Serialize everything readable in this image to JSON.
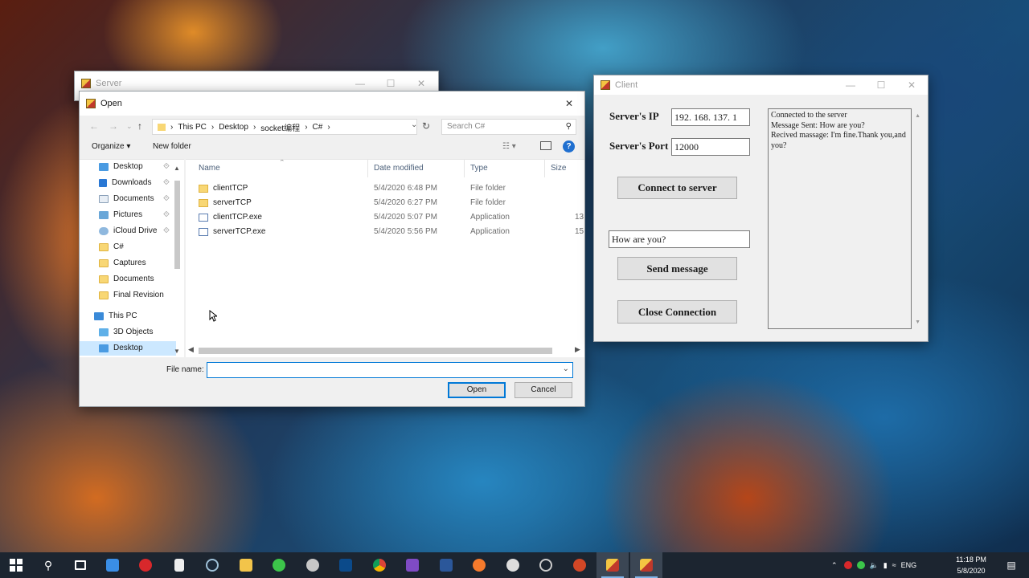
{
  "server_window": {
    "title": "Server"
  },
  "open_dialog": {
    "title": "Open",
    "path": [
      "This PC",
      "Desktop",
      "socket编程",
      "C#"
    ],
    "search_placeholder": "Search C#",
    "toolbar": {
      "organize": "Organize ▾",
      "new_folder": "New folder"
    },
    "nav_items": [
      {
        "label": "Desktop",
        "icon": "desktop-icon",
        "pinned": true
      },
      {
        "label": "Downloads",
        "icon": "download-icon",
        "pinned": true
      },
      {
        "label": "Documents",
        "icon": "documents-icon",
        "pinned": true
      },
      {
        "label": "Pictures",
        "icon": "pictures-icon",
        "pinned": true
      },
      {
        "label": "iCloud Drive",
        "icon": "cloud-icon",
        "pinned": true
      },
      {
        "label": "C#",
        "icon": "folder-icon",
        "pinned": false
      },
      {
        "label": "Captures",
        "icon": "folder-icon",
        "pinned": false
      },
      {
        "label": "Documents",
        "icon": "folder-icon",
        "pinned": false
      },
      {
        "label": "Final Revision",
        "icon": "folder-icon",
        "pinned": false
      },
      {
        "label": "This PC",
        "icon": "computer-icon",
        "pinned": false
      },
      {
        "label": "3D Objects",
        "icon": "cube-icon",
        "pinned": false
      },
      {
        "label": "Desktop",
        "icon": "desktop-icon",
        "pinned": false
      }
    ],
    "columns": [
      "Name",
      "Date modified",
      "Type",
      "Size"
    ],
    "files": [
      {
        "name": "clientTCP",
        "date": "5/4/2020 6:48 PM",
        "type": "File folder",
        "size": "",
        "icon": "folder-icon"
      },
      {
        "name": "serverTCP",
        "date": "5/4/2020 6:27 PM",
        "type": "File folder",
        "size": "",
        "icon": "folder-icon"
      },
      {
        "name": "clientTCP.exe",
        "date": "5/4/2020 5:07 PM",
        "type": "Application",
        "size": "13",
        "icon": "app-icon"
      },
      {
        "name": "serverTCP.exe",
        "date": "5/4/2020 5:56 PM",
        "type": "Application",
        "size": "15",
        "icon": "app-icon"
      }
    ],
    "file_name_label": "File name:",
    "file_name_value": "",
    "open_label": "Open",
    "cancel_label": "Cancel"
  },
  "client_window": {
    "title": "Client",
    "ip_label": "Server's IP",
    "ip_value": "192. 168. 137. 1",
    "port_label": "Server's Port",
    "port_value": "12000",
    "connect_label": "Connect to server",
    "message_value": "How are you?",
    "send_label": "Send message",
    "close_label": "Close Connection",
    "log": [
      "Connected to the server",
      "Message Sent: How are you?",
      "Recived massage: I'm fine.Thank you,and you?"
    ]
  },
  "taskbar": {
    "apps": [
      "start-icon",
      "search-icon",
      "task-view-icon",
      "store-icon",
      "netease-icon",
      "calculator-icon",
      "steam-icon",
      "file-explorer-icon",
      "wechat-icon",
      "paint-icon",
      "terminal-icon",
      "chrome-icon",
      "visual-studio-icon",
      "word-icon",
      "firefox-icon",
      "clock-app-icon",
      "media-icon",
      "powerpoint-icon",
      "server-app-icon",
      "client-app-icon"
    ],
    "tray": {
      "lang": "ENG"
    },
    "time": "11:18 PM",
    "date": "5/8/2020"
  }
}
